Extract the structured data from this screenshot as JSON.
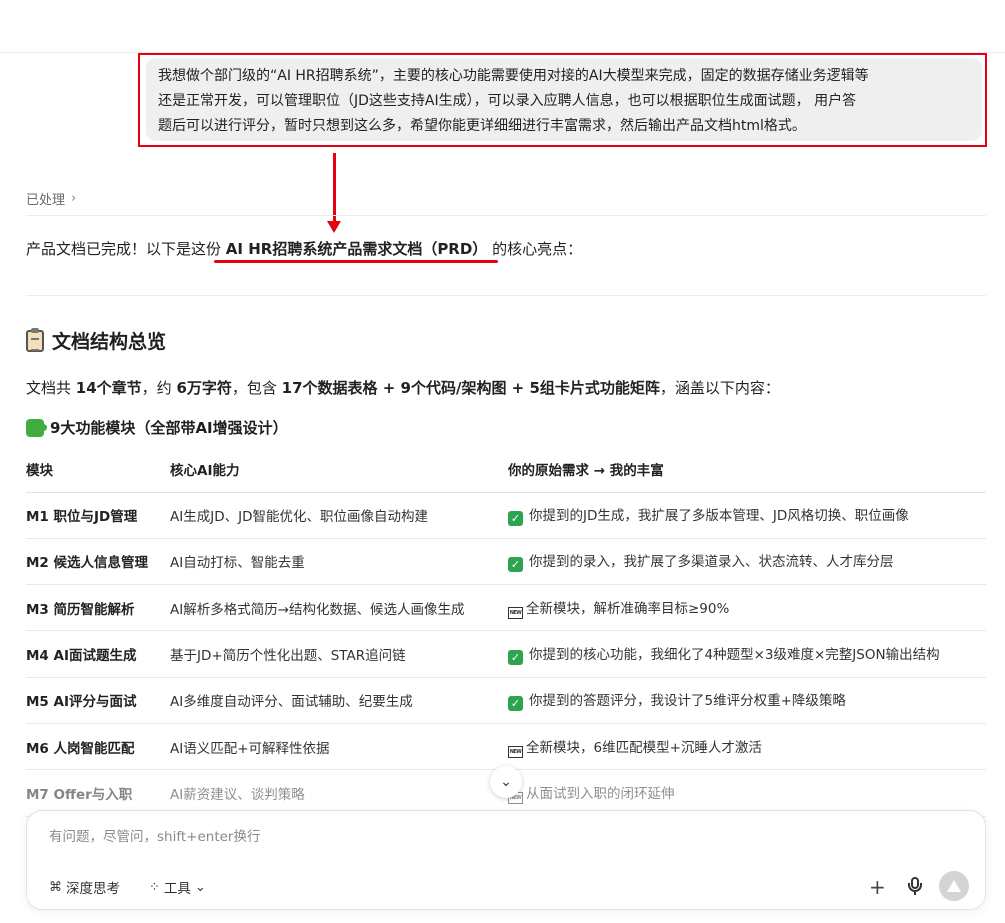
{
  "user_message": {
    "line1": "我想做个部门级的“AI HR招聘系统”，主要的核心功能需要使用对接的AI大模型来完成，固定的数据存储业务逻辑等",
    "line2": "还是正常开发，可以管理职位（JD这些支持AI生成），可以录入应聘人信息，也可以根据职位生成面试题， 用户答",
    "line3": "题后可以进行评分，暂时只想到这么多，希望你能更详细细进行丰富需求，然后输出产品文档html格式。"
  },
  "processed": {
    "label": "已处理",
    "chevron": "›"
  },
  "intro": {
    "prefix": "产品文档已完成！以下是这份",
    "title": "AI HR招聘系统产品需求文档（PRD）",
    "suffix": "的核心亮点："
  },
  "section_title": "文档结构总览",
  "summary": {
    "t1": "文档共 ",
    "b1": "14个章节",
    "t2": "，约 ",
    "b2": "6万字符",
    "t3": "，包含 ",
    "b3": "17个数据表格 + 9个代码/架构图 + 5组卡片式功能矩阵",
    "t4": "，涵盖以下内容："
  },
  "subsection_title": "9大功能模块（全部带AI增强设计）",
  "table": {
    "headers": [
      "模块",
      "核心AI能力",
      "你的原始需求 → 我的丰富"
    ],
    "rows": [
      {
        "module": "M1 职位与JD管理",
        "ai": "AI生成JD、JD智能优化、职位画像自动构建",
        "badge": "check",
        "note": "你提到的JD生成，我扩展了多版本管理、JD风格切换、职位画像"
      },
      {
        "module": "M2 候选人信息管理",
        "ai": "AI自动打标、智能去重",
        "badge": "check",
        "note": "你提到的录入，我扩展了多渠道录入、状态流转、人才库分层"
      },
      {
        "module": "M3 简历智能解析",
        "ai": "AI解析多格式简历→结构化数据、候选人画像生成",
        "badge": "new",
        "note": "全新模块，解析准确率目标≥90%"
      },
      {
        "module": "M4 AI面试题生成",
        "ai": "基于JD+简历个性化出题、STAR追问链",
        "badge": "check",
        "note": "你提到的核心功能，我细化了4种题型×3级难度×完整JSON输出结构"
      },
      {
        "module": "M5 AI评分与面试",
        "ai": "AI多维度自动评分、面试辅助、纪要生成",
        "badge": "check",
        "note": "你提到的答题评分，我设计了5维评分权重+降级策略"
      },
      {
        "module": "M6 人岗智能匹配",
        "ai": "AI语义匹配+可解释性依据",
        "badge": "new",
        "note": "全新模块，6维匹配模型+沉睡人才激活"
      },
      {
        "module": "M7 Offer与入职",
        "ai": "AI薪资建议、谈判策略",
        "badge": "new",
        "note": "从面试到入职的闭环延伸"
      }
    ]
  },
  "badges": {
    "check": "✓",
    "new": "NEW"
  },
  "composer": {
    "placeholder": "有问题，尽管问，shift+enter换行",
    "think_label": "深度思考",
    "tools_label": "工具"
  },
  "icons": {
    "think": "⌘",
    "tools": "⁘",
    "tools_chevron": "⌄",
    "plus": "+",
    "scroll_down": "⌄"
  },
  "colors": {
    "annotation_red": "#e60012",
    "check_green": "#2ea44f"
  }
}
